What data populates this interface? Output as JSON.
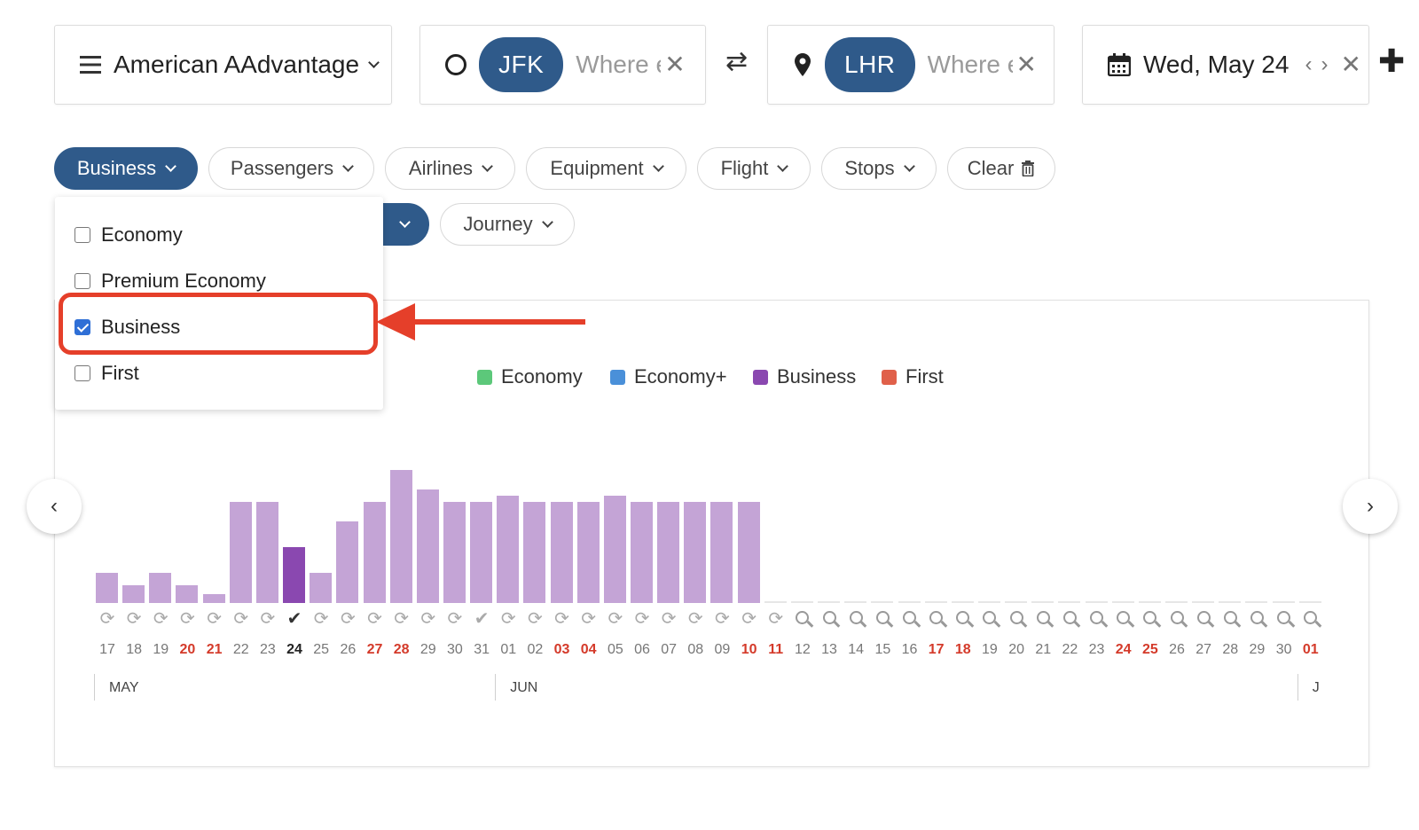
{
  "search": {
    "program": "American AAdvantage",
    "origin": "JFK",
    "origin_placeholder": "Where else?",
    "destination": "LHR",
    "destination_placeholder": "Where else?",
    "date": "Wed, May 24"
  },
  "filters": {
    "chips": [
      "Business",
      "Passengers",
      "Airlines",
      "Equipment",
      "Flight",
      "Stops",
      "Clear"
    ],
    "second_row": [
      "Journey"
    ]
  },
  "cabin_dropdown": {
    "options": [
      {
        "label": "Economy",
        "checked": false
      },
      {
        "label": "Premium Economy",
        "checked": false
      },
      {
        "label": "Business",
        "checked": true
      },
      {
        "label": "First",
        "checked": false
      }
    ]
  },
  "legend": [
    {
      "label": "Economy",
      "color": "#5cc87a"
    },
    {
      "label": "Economy+",
      "color": "#4a90d9"
    },
    {
      "label": "Business",
      "color": "#8a48b0"
    },
    {
      "label": "First",
      "color": "#e0604a"
    }
  ],
  "chart_data": {
    "type": "bar",
    "series": [
      {
        "name": "Business",
        "color": "#c4a4d6",
        "selected_color": "#8a48b0"
      }
    ],
    "categories": [
      "17",
      "18",
      "19",
      "20",
      "21",
      "22",
      "23",
      "24",
      "25",
      "26",
      "27",
      "28",
      "29",
      "30",
      "31",
      "01",
      "02",
      "03",
      "04",
      "05",
      "06",
      "07",
      "08",
      "09",
      "10",
      "11",
      "12",
      "13",
      "14",
      "15",
      "16",
      "17",
      "18",
      "19",
      "20",
      "21",
      "22",
      "23",
      "24",
      "25",
      "26",
      "27",
      "28",
      "29",
      "30",
      "01"
    ],
    "values": [
      34,
      20,
      34,
      20,
      10,
      114,
      114,
      63,
      34,
      92,
      114,
      150,
      128,
      114,
      114,
      121,
      114,
      114,
      114,
      121,
      114,
      114,
      114,
      114,
      114,
      null,
      null,
      null,
      null,
      null,
      null,
      null,
      null,
      null,
      null,
      null,
      null,
      null,
      null,
      null,
      null,
      null,
      null,
      null,
      null,
      null
    ],
    "weekend_indices": [
      3,
      4,
      10,
      11,
      17,
      18,
      24,
      25,
      31,
      32,
      38,
      39,
      45
    ],
    "selected_index": 7,
    "status": [
      "sync",
      "sync",
      "sync",
      "sync",
      "sync",
      "sync",
      "sync",
      "check",
      "sync",
      "sync",
      "sync",
      "sync",
      "sync",
      "sync",
      "check-light",
      "sync",
      "sync",
      "sync",
      "sync",
      "sync",
      "sync",
      "sync",
      "sync",
      "sync",
      "sync",
      "sync",
      "search",
      "search",
      "search",
      "search",
      "search",
      "search",
      "search",
      "search",
      "search",
      "search",
      "search",
      "search",
      "search",
      "search",
      "search",
      "search",
      "search",
      "search",
      "search",
      "search"
    ],
    "months": [
      {
        "label": "MAY",
        "start_index": 0
      },
      {
        "label": "JUN",
        "start_index": 15
      },
      {
        "label": "J",
        "start_index": 45
      }
    ]
  }
}
